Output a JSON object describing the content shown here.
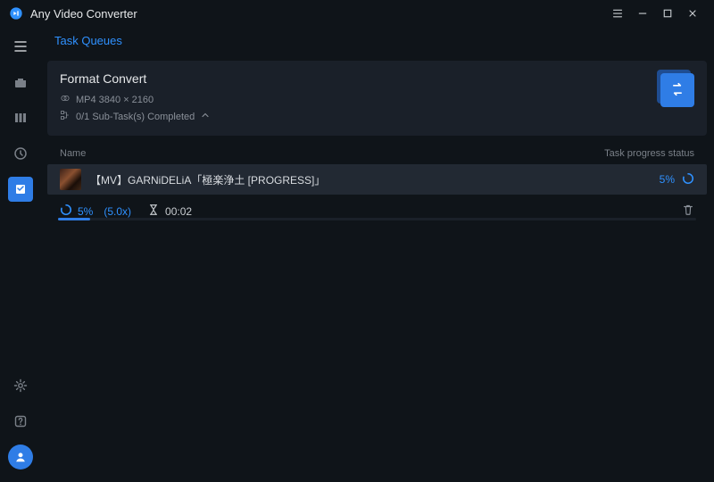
{
  "app": {
    "title": "Any Video Converter"
  },
  "sidebar": {
    "items": [
      {
        "name": "hamburger-icon"
      },
      {
        "name": "toolbox-icon"
      },
      {
        "name": "bars-icon"
      },
      {
        "name": "clock-icon"
      },
      {
        "name": "queue-icon",
        "active": true
      },
      {
        "name": "gear-icon"
      },
      {
        "name": "help-icon"
      }
    ]
  },
  "tabs": [
    {
      "label": "Task Queues",
      "active": true
    }
  ],
  "card": {
    "title": "Format Convert",
    "format": "MP4 3840 × 2160",
    "subtasks": "0/1 Sub-Task(s) Completed"
  },
  "list": {
    "col_name": "Name",
    "col_status": "Task progress status"
  },
  "task": {
    "name": "【MV】GARNiDELiA「極楽浄土 [PROGRESS]」",
    "pct": "5%"
  },
  "footer": {
    "pct": "5%",
    "speed": "(5.0x)",
    "time": "00:02"
  }
}
